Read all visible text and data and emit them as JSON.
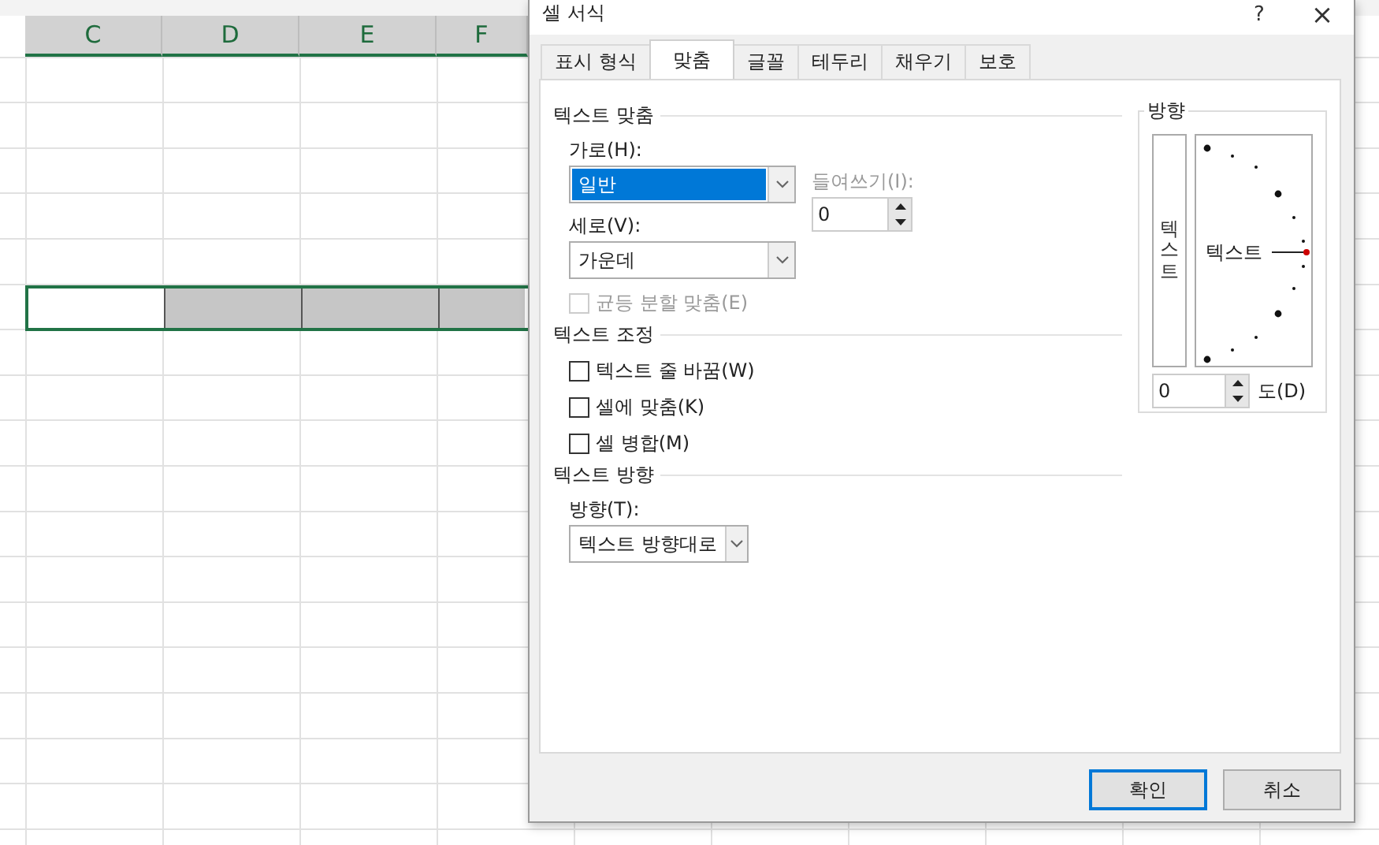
{
  "sheet": {
    "columns": [
      {
        "label": "C"
      },
      {
        "label": "D"
      },
      {
        "label": "E"
      },
      {
        "label": "F"
      }
    ],
    "selection": [
      {
        "active": true
      },
      {
        "active": false
      },
      {
        "active": false
      },
      {
        "active": false
      }
    ]
  },
  "window": {
    "title": "셀 서식",
    "help": "?",
    "close": "×"
  },
  "tabs": [
    {
      "label": "표시 형식",
      "selected": false
    },
    {
      "label": "맞춤",
      "selected": true
    },
    {
      "label": "글꼴",
      "selected": false
    },
    {
      "label": "테두리",
      "selected": false
    },
    {
      "label": "채우기",
      "selected": false
    },
    {
      "label": "보호",
      "selected": false
    }
  ],
  "text_alignment": {
    "legend": "텍스트 맞춤",
    "horizontal": {
      "label": "가로(H):",
      "value": "일반",
      "focused": true
    },
    "indent": {
      "label": "들여쓰기(I):",
      "value": "0",
      "disabled": true
    },
    "vertical": {
      "label": "세로(V):",
      "value": "가운데",
      "focused": false
    },
    "distributed": {
      "label": "균등 분할 맞춤(E)",
      "checked": false,
      "disabled": true
    }
  },
  "text_control": {
    "legend": "텍스트 조정",
    "options": [
      {
        "label": "텍스트 줄 바꿈(W)",
        "checked": false
      },
      {
        "label": "셀에 맞춤(K)",
        "checked": false
      },
      {
        "label": "셀 병합(M)",
        "checked": false
      }
    ]
  },
  "text_direction": {
    "legend": "텍스트 방향",
    "label": "방향(T):",
    "value": "텍스트 방향대로"
  },
  "orientation": {
    "legend": "방향",
    "vertical_text": "텍스트",
    "dial_text": "텍스트",
    "degrees": "0",
    "degrees_label": "도(D)"
  },
  "buttons": [
    {
      "label": "확인",
      "default": true
    },
    {
      "label": "취소",
      "default": false
    }
  ]
}
